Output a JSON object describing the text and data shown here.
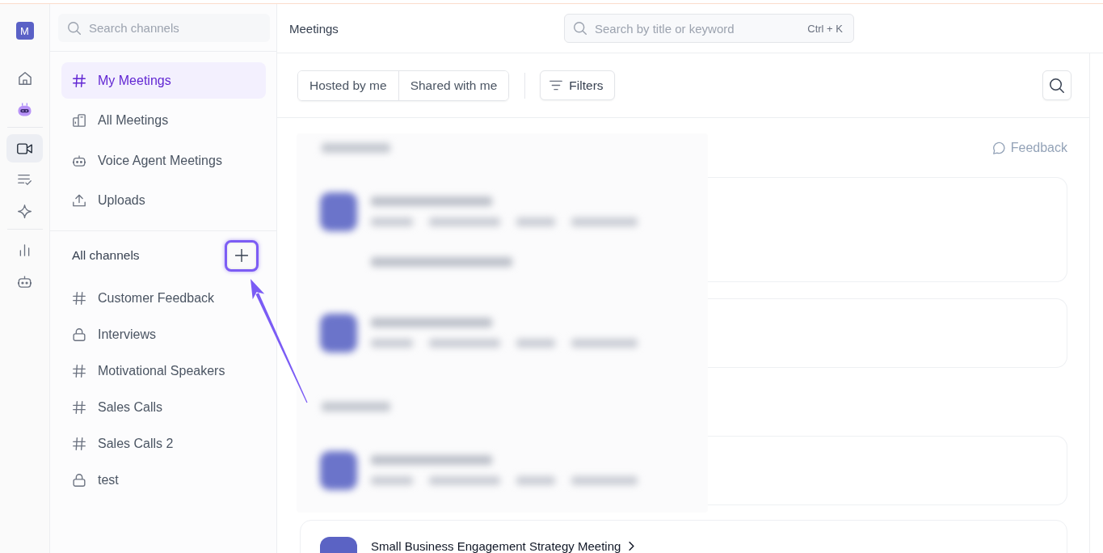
{
  "rail": {
    "logo": "M",
    "groups": [
      [
        {
          "kind": "home",
          "selected": false
        },
        {
          "kind": "assistant",
          "selected": false
        }
      ],
      [
        {
          "kind": "meetings",
          "selected": true
        },
        {
          "kind": "tasks",
          "selected": false
        },
        {
          "kind": "ai",
          "selected": false
        }
      ],
      [
        {
          "kind": "analytics",
          "selected": false
        },
        {
          "kind": "agents",
          "selected": false
        }
      ]
    ]
  },
  "sidebar": {
    "search": {
      "placeholder": "Search channels"
    },
    "nav": [
      {
        "label": "My Meetings",
        "kind": "channel",
        "selected": true
      },
      {
        "label": "All Meetings",
        "kind": "library",
        "selected": false
      },
      {
        "label": "Voice Agent Meetings",
        "kind": "agent",
        "selected": false
      },
      {
        "label": "Uploads",
        "kind": "upload",
        "selected": false
      }
    ],
    "channels": {
      "title": "All channels",
      "add_button": {
        "highlighted": true,
        "pointer_arrow": true
      },
      "items": [
        {
          "name": "Customer Feedback",
          "private": false
        },
        {
          "name": "Interviews",
          "private": true
        },
        {
          "name": "Motivational Speakers",
          "private": false
        },
        {
          "name": "Sales Calls",
          "private": false
        },
        {
          "name": "Sales Calls 2",
          "private": false
        },
        {
          "name": "test",
          "private": true
        }
      ]
    }
  },
  "header": {
    "title": "Meetings",
    "search": {
      "placeholder": "Search by title or keyword",
      "shortcut": "Ctrl + K"
    }
  },
  "toolbar": {
    "tabs": [
      {
        "label": "Hosted by me",
        "selected": false
      },
      {
        "label": "Shared with me",
        "selected": false
      }
    ],
    "filters_button": "Filters"
  },
  "feedback_link": "Feedback",
  "hidden_section": {
    "blurred": true,
    "groups": [
      {
        "meetings": [
          {
            "tagged": true
          },
          {
            "tagged": false
          }
        ]
      },
      {
        "meetings": [
          {
            "tagged": false
          }
        ]
      }
    ]
  },
  "meetings": [
    {
      "title": "Small Business Engagement Strategy Meeting"
    }
  ]
}
